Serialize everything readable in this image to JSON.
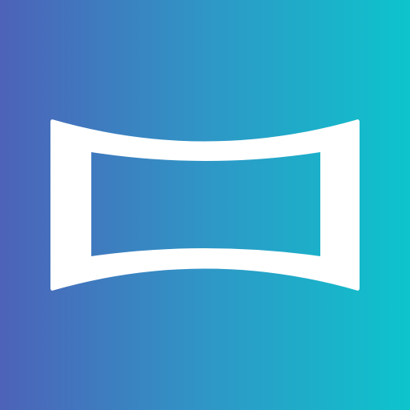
{
  "app_icon": {
    "icon": "panorama-icon",
    "colors": {
      "gradient_start": "#4d62b8",
      "gradient_mid": "#2f96c6",
      "gradient_end": "#0dc4cc",
      "glyph": "#ffffff"
    }
  }
}
